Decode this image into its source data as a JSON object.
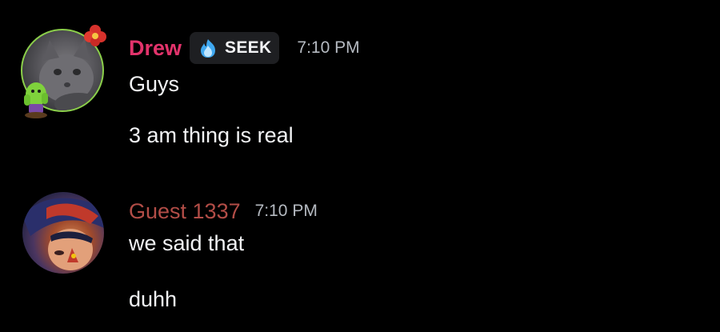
{
  "messages": [
    {
      "author": "Drew",
      "author_color": "#e2336b",
      "tag": {
        "label": "SEEK",
        "icon": "blue-flame-icon"
      },
      "time": "7:10 PM",
      "avatar": "cat-avatar",
      "lines": [
        "Guys",
        "3 am thing is real"
      ]
    },
    {
      "author": "Guest 1337",
      "author_color": "#b24d47",
      "time": "7:10 PM",
      "avatar": "anime-character-avatar",
      "lines": [
        "we said that",
        "duhh"
      ]
    }
  ],
  "colors": {
    "background": "#000000",
    "text": "#f2f3f5",
    "timestamp": "#b5bac1",
    "tag_background": "#1e1f22"
  }
}
